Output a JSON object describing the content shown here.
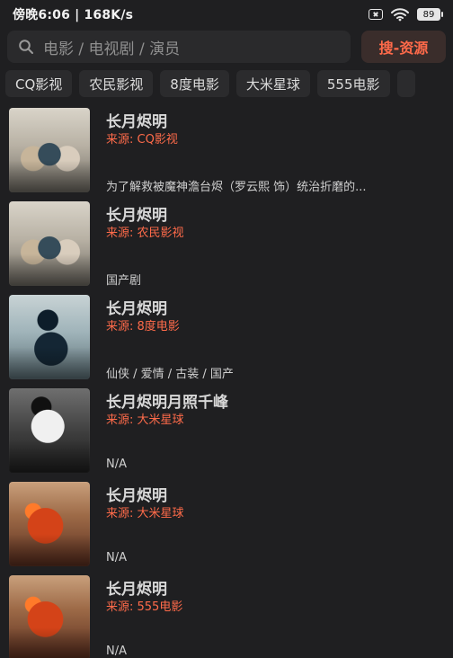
{
  "status_bar": {
    "left_text": "傍晚6:06 | 168K/s",
    "battery": "89",
    "icons": [
      "notification-x-icon",
      "wifi-icon",
      "battery-icon"
    ]
  },
  "search": {
    "placeholder": "电影 / 电视剧 / 演员",
    "button_label": "搜-资源"
  },
  "sources": [
    {
      "label": "CQ影视"
    },
    {
      "label": "农民影视"
    },
    {
      "label": "8度电影"
    },
    {
      "label": "大米星球"
    },
    {
      "label": "555电影"
    }
  ],
  "results": [
    {
      "title": "长月烬明",
      "source": "来源: CQ影视",
      "desc": "为了解救被魔神澹台烬（罗云熙 饰）统治折磨的..."
    },
    {
      "title": "长月烬明",
      "source": "来源: 农民影视",
      "desc": "国产剧"
    },
    {
      "title": "长月烬明",
      "source": "来源: 8度电影",
      "desc": "仙侠 / 爱情 / 古装 / 国产"
    },
    {
      "title": "长月烬明月照千峰",
      "source": "来源: 大米星球",
      "desc": "N/A"
    },
    {
      "title": "长月烬明",
      "source": "来源: 大米星球",
      "desc": "N/A"
    },
    {
      "title": "长月烬明",
      "source": "来源: 555电影",
      "desc": "N/A"
    }
  ],
  "colors": {
    "background": "#1f1f21",
    "accent": "#ff6b4a",
    "chip_bg": "#2b2b2d"
  }
}
